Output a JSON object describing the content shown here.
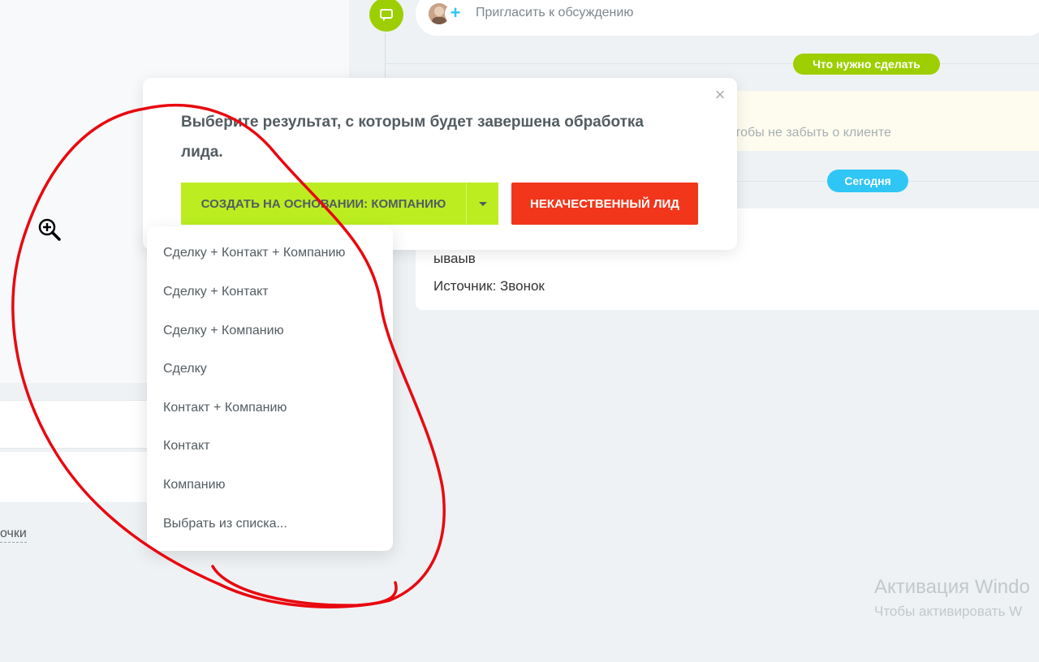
{
  "timeline": {
    "invite_text": "Пригласить к обсуждению",
    "todo_badge": "Что нужно сделать",
    "note_text": "тобы не забыть о клиенте",
    "today_badge": "Сегодня",
    "lead_name": "ываыв",
    "lead_source": "Источник: Звонок"
  },
  "left_panel": {
    "link_text": "очки"
  },
  "popup": {
    "title": "Выберите результат, с которым будет завершена обработка лида.",
    "close_glyph": "×",
    "create_button": "СОЗДАТЬ НА ОСНОВАНИИ: КОМПАНИЮ",
    "bad_lead_button": "НЕКАЧЕСТВЕННЫЙ ЛИД"
  },
  "menu": {
    "items": [
      "Сделку + Контакт + Компанию",
      "Сделку + Контакт",
      "Сделку + Компанию",
      "Сделку",
      "Контакт + Компанию",
      "Контакт",
      "Компанию",
      "Выбрать из списка..."
    ]
  },
  "watermark": {
    "title": "Активация Windo",
    "subtitle": "Чтобы активировать W"
  },
  "colors": {
    "green": "#9dcf00",
    "lime_button": "#bbed21",
    "red_button": "#f1361b",
    "blue_badge": "#2fc6f6",
    "annotation_red": "#e8090f"
  }
}
